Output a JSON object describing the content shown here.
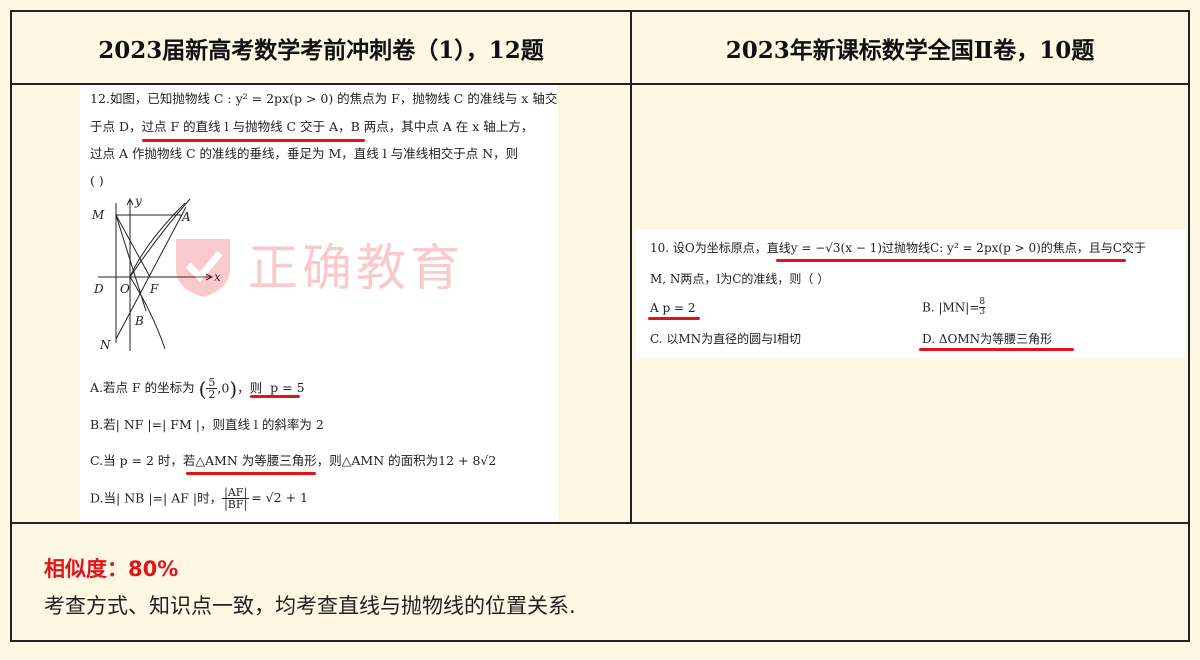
{
  "header": {
    "left_title": "2023届新高考数学考前冲刺卷（1），12题",
    "right_title": "2023年新课标数学全国Ⅱ卷，10题"
  },
  "left_problem": {
    "line1": "12.如图，已知抛物线 C : y² = 2px(p > 0) 的焦点为 F，抛物线 C 的准线与 x 轴交",
    "line2_pre": "于点 D，",
    "line2_underlined": "过点 F 的直线 l 与抛物线 C 交于 A，B 两点，",
    "line2_post": "其中点 A 在 x 轴上方，",
    "line3": "过点 A 作抛物线 C 的准线的垂线，垂足为 M，直线 l 与准线相交于点 N，则",
    "line4": "(      )",
    "figure_labels": {
      "M": "M",
      "y": "y",
      "A": "A",
      "x": "x",
      "D": "D",
      "O": "O",
      "F": "F",
      "B": "B",
      "N": "N"
    },
    "option_a_pre": "A.若点 F 的坐标为",
    "option_a_frac_num": "5",
    "option_a_frac_den": "2",
    "option_a_mid": ",0",
    "option_a_post": "，则",
    "option_a_underlined": "p = 5",
    "option_b": "B.若| NF |=| FM |，则直线 l 的斜率为 2",
    "option_c_pre": "C.当 p = 2 时，",
    "option_c_underlined": "若△AMN 为等腰三角形",
    "option_c_post": "，则△AMN 的面积为12 + 8√2",
    "option_d_pre": "D.当| NB |=| AF |时，",
    "option_d_num": "|AF|",
    "option_d_den": "|BF|",
    "option_d_post": "= √2 + 1"
  },
  "watermark": {
    "text": "正确教育",
    "color": "#e0141a"
  },
  "right_problem": {
    "line1_pre": "10. 设O为坐标原点，",
    "line1_underlined": "直线y = −√3(x − 1)过抛物线C: y² = 2px(p > 0)的焦点，",
    "line1_post": "且与C交于",
    "line2": "M, N两点，l为C的准线，则（    ）",
    "option_a": "A  p = 2",
    "option_b_pre": "B.  |MN|=",
    "option_b_num": "8",
    "option_b_den": "3",
    "option_c": "C.  以MN为直径的圆与l相切",
    "option_d": "D.  ΔOMN为等腰三角形"
  },
  "footer": {
    "similarity": "相似度：80%",
    "description": "考查方式、知识点一致，均考查直线与抛物线的位置关系."
  },
  "colors": {
    "background": "#fdf7e3",
    "accent": "#e0141a"
  }
}
